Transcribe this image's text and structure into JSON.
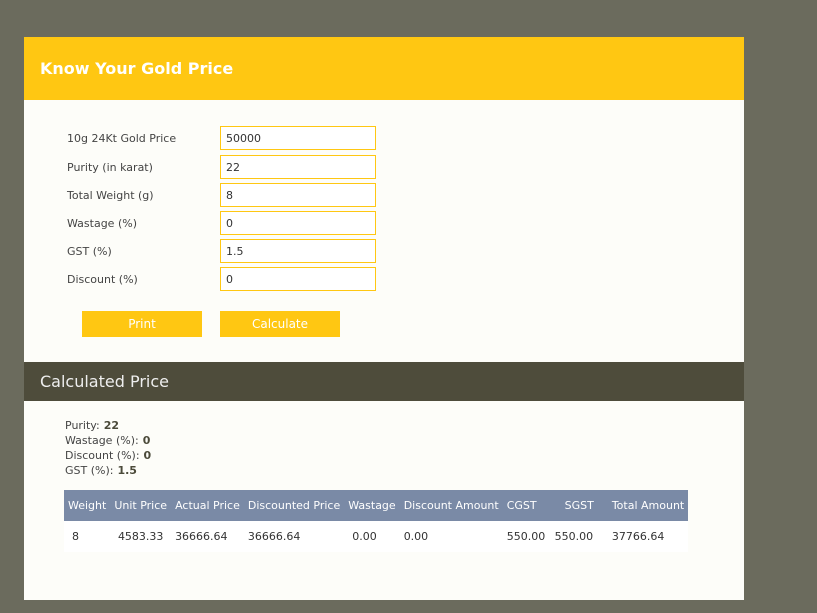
{
  "header": {
    "title": "Know Your Gold Price"
  },
  "colors": {
    "accent": "#ffc712",
    "dark_bar": "#4e4c3b",
    "table_header": "#7a8aa6",
    "page_bg": "#6b6b5d"
  },
  "form": {
    "fields": [
      {
        "label": "10g 24Kt Gold Price",
        "value": "50000"
      },
      {
        "label": "Purity (in karat)",
        "value": "22"
      },
      {
        "label": "Total Weight (g)",
        "value": "8"
      },
      {
        "label": "Wastage (%)",
        "value": "0"
      },
      {
        "label": "GST (%)",
        "value": "1.5"
      },
      {
        "label": "Discount (%)",
        "value": "0"
      }
    ],
    "print_label": "Print",
    "calculate_label": "Calculate"
  },
  "result": {
    "title": "Calculated Price",
    "summary": [
      {
        "label": "Purity:",
        "value": "22"
      },
      {
        "label": "Wastage (%):",
        "value": "0"
      },
      {
        "label": "Discount (%):",
        "value": "0"
      },
      {
        "label": "GST (%):",
        "value": "1.5"
      }
    ],
    "columns": [
      "Weight",
      "Unit Price",
      "Actual Price",
      "Discounted Price",
      "Wastage",
      "Discount Amount",
      "CGST",
      "SGST",
      "Total Amount"
    ],
    "rows": [
      [
        "8",
        "4583.33",
        "36666.64",
        "36666.64",
        "0.00",
        "0.00",
        "550.00",
        "550.00",
        "37766.64"
      ]
    ]
  }
}
